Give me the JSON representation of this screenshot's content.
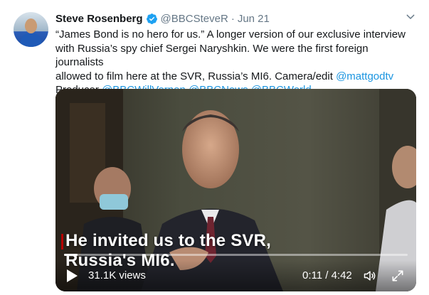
{
  "tweet": {
    "author_name": "Steve Rosenberg",
    "handle": "@BBCSteveR",
    "separator": "·",
    "time": "Jun 21",
    "text_line1": "“James Bond is no hero for us.”  A longer version of our exclusive interview",
    "text_line2": "with Russia’s spy chief Sergei Naryshkin. We were the first foreign journalists",
    "text_line3_plain": "allowed to film here at the SVR, Russia’s MI6. Camera/edit ",
    "mention_mattgod": "@mattgodtv",
    "text_line4_plain": "Producer ",
    "mention_vernon": "@BBCWillVernon",
    "mention_news": "@BBCNews",
    "mention_world": "@BBCWorld",
    "text_end": "."
  },
  "video": {
    "caption_line1": "He invited us to the SVR,",
    "caption_line2": "Russia's MI6.",
    "views": "31.1K views",
    "duration": "0:11 / 4:42",
    "progress_fraction": 0.04
  },
  "icons": {
    "verified": "verified-badge-icon",
    "more": "chevron-down-icon",
    "play": "play-icon",
    "volume": "volume-icon",
    "fullscreen": "fullscreen-icon"
  },
  "colors": {
    "link": "#1b95e0",
    "verified": "#1da1f2",
    "caption_accent": "#b80000"
  }
}
